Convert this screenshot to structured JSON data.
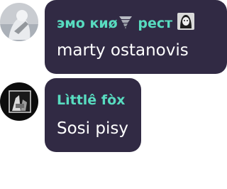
{
  "messages": [
    {
      "author_prefix": "эмо киø",
      "author_suffix": "рест",
      "author_emoji_1": "tornado-emoji",
      "author_emoji_2": "face-portrait-icon",
      "text": "marty ostanovis",
      "avatar_icon": "user-avatar-grey-photo"
    },
    {
      "author": "Lìttlê fòx",
      "text": "Sosi pisy",
      "avatar_icon": "user-avatar-dark-photo"
    }
  ],
  "colors": {
    "bubble": "#312a44",
    "author": "#58dcc0",
    "text": "#ffffff"
  }
}
